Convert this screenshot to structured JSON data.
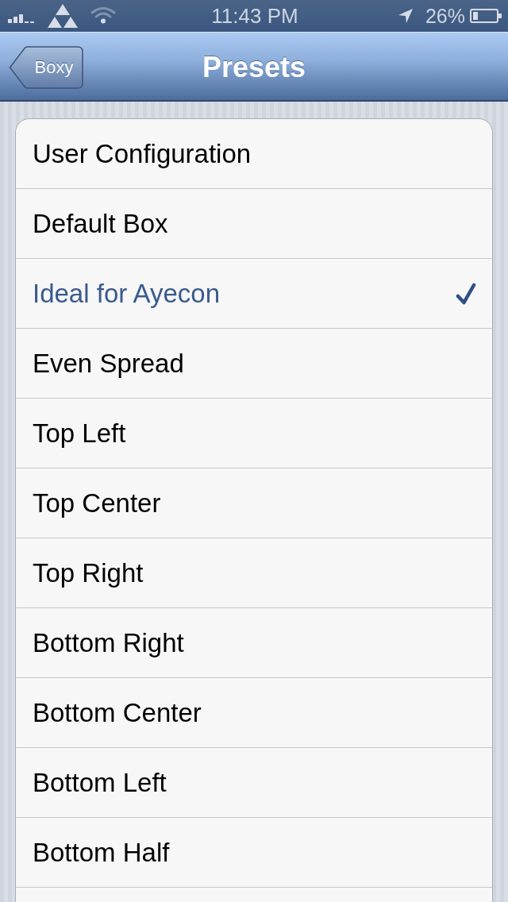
{
  "status_bar": {
    "time": "11:43 PM",
    "battery": "26%"
  },
  "nav_bar": {
    "back_button": "Boxy",
    "title": "Presets"
  },
  "presets": [
    {
      "label": "User Configuration",
      "selected": false
    },
    {
      "label": "Default Box",
      "selected": false
    },
    {
      "label": "Ideal for Ayecon",
      "selected": true
    },
    {
      "label": "Even Spread",
      "selected": false
    },
    {
      "label": "Top Left",
      "selected": false
    },
    {
      "label": "Top Center",
      "selected": false
    },
    {
      "label": "Top Right",
      "selected": false
    },
    {
      "label": "Bottom Right",
      "selected": false
    },
    {
      "label": "Bottom Center",
      "selected": false
    },
    {
      "label": "Bottom Left",
      "selected": false
    },
    {
      "label": "Bottom Half",
      "selected": false
    }
  ]
}
